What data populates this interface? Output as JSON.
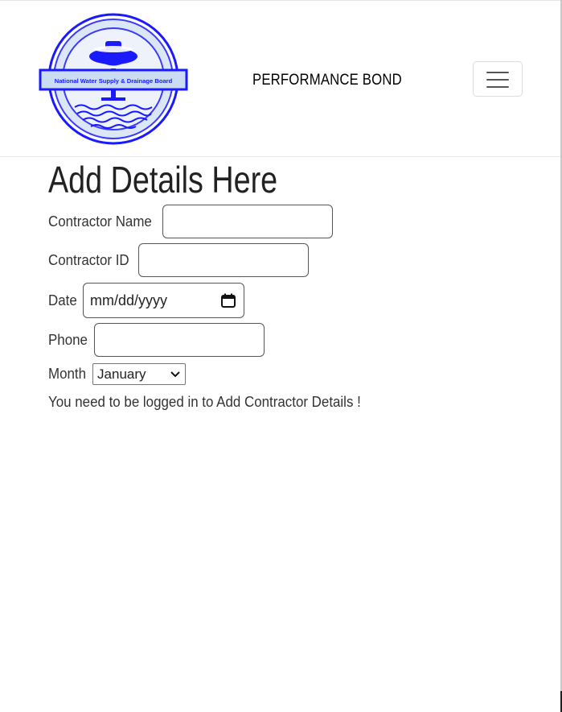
{
  "navbar": {
    "brand": "PERFORMANCE BOND",
    "logo_text": "National Water Supply & Drainage Board"
  },
  "form": {
    "title": "Add Details Here",
    "contractor_name_label": "Contractor Name",
    "contractor_name_value": "",
    "contractor_id_label": "Contractor ID",
    "contractor_id_value": "",
    "date_label": "Date",
    "date_placeholder": "mm/dd/yyyy",
    "phone_label": "Phone",
    "phone_value": "",
    "month_label": "Month",
    "month_selected": "January"
  },
  "message": "You need to be logged in to Add Contractor Details !",
  "colors": {
    "logo_blue": "#1a1aff",
    "logo_fill": "#c9dcf2",
    "text": "#333333"
  },
  "icons": [
    "hamburger-menu-icon",
    "calendar-icon",
    "chevron-down-icon"
  ]
}
